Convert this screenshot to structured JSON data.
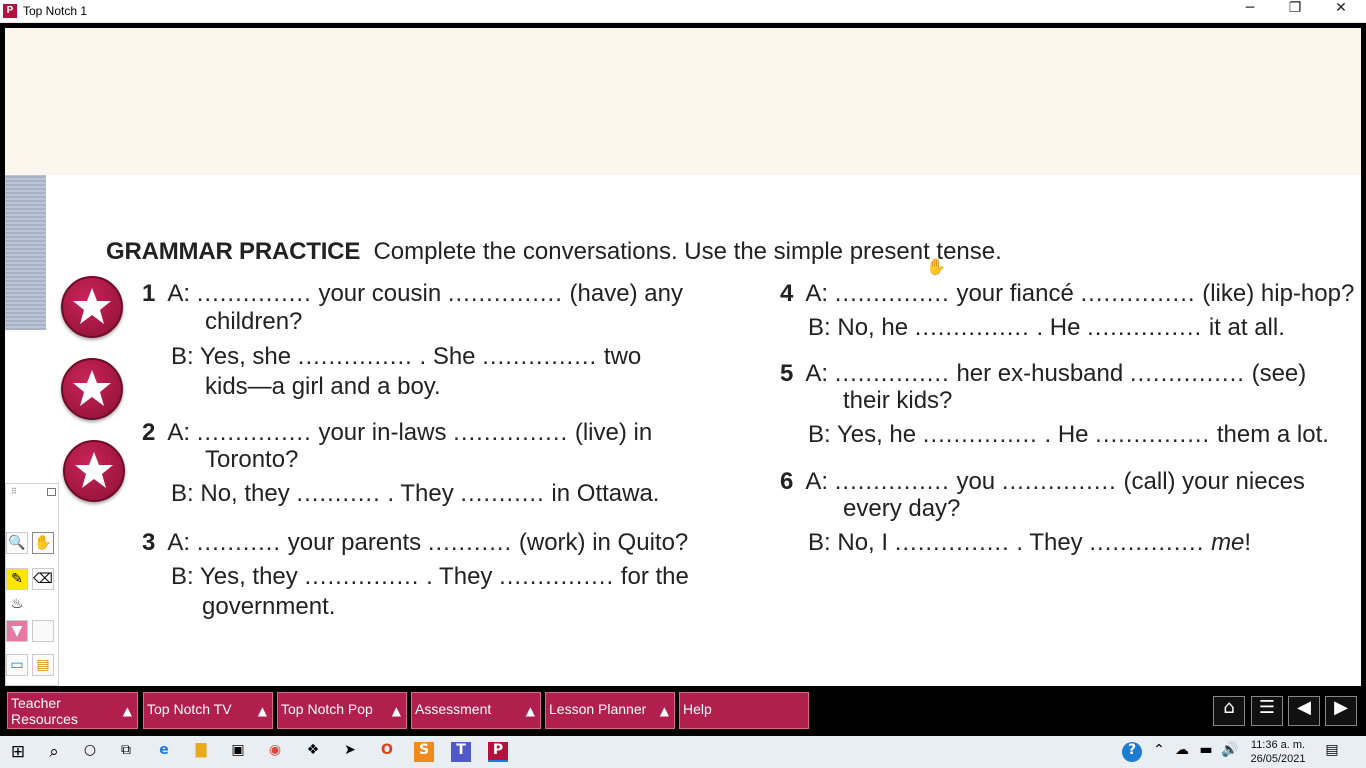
{
  "window": {
    "title": "Top Notch 1",
    "app_icon_letter": "P",
    "minimize": "─",
    "restore": "❐",
    "close": "✕"
  },
  "lesson": {
    "heading_bold": "GRAMMAR PRACTICE",
    "heading_text": "Complete the conversations. Use the simple present tense.",
    "blank": "...............",
    "short_blank": "...........",
    "exercises": {
      "e1": {
        "num": "1",
        "a1": "A:",
        "a2": "your cousin",
        "a3": "(have) any",
        "a4": "children?",
        "b1": "B:",
        "b2": "Yes, she",
        "b3": ". She",
        "b4": "two",
        "b5": "kids—a girl and a boy."
      },
      "e2": {
        "num": "2",
        "a1": "A:",
        "a2": "your in-laws",
        "a3": "(live) in",
        "a4": "Toronto?",
        "b1": "B:",
        "b2": "No, they",
        "b3": ". They",
        "b4": "in Ottawa."
      },
      "e3": {
        "num": "3",
        "a1": "A:",
        "a2": "your parents",
        "a3": "(work) in Quito?",
        "b1": "B:",
        "b2": "Yes, they",
        "b3": ". They",
        "b4": "for the",
        "b5": "government."
      },
      "e4": {
        "num": "4",
        "a1": "A:",
        "a2": "your fiancé",
        "a3": "(like) hip-hop?",
        "b1": "B:",
        "b2": "No, he",
        "b3": ". He",
        "b4": "it at all."
      },
      "e5": {
        "num": "5",
        "a1": "A:",
        "a2": "her ex-husband",
        "a3": "(see)",
        "a4": "their kids?",
        "b1": "B:",
        "b2": "Yes, he",
        "b3": ". He",
        "b4": "them a lot."
      },
      "e6": {
        "num": "6",
        "a1": "A:",
        "a2": "you",
        "a3": "(call) your nieces",
        "a4": "every day?",
        "b1": "B:",
        "b2": "No, I",
        "b3": ". They",
        "b4": "me",
        "b5": "!"
      }
    }
  },
  "toolbar": {
    "grip": "⠿",
    "zoom_icon": "🔍",
    "hand_icon": "✋",
    "highlighter_icon": "✎",
    "eraser_icon": "⌫",
    "spray_icon": "♨",
    "color_swatch": "▼",
    "screen_icon": "▭",
    "folder_icon": "▤",
    "pink": "#e47aa0"
  },
  "menu": {
    "teacher_resources": "Teacher Resources",
    "top_notch_tv": "Top Notch TV",
    "top_notch_pop": "Top Notch Pop",
    "assessment": "Assessment",
    "lesson_planner": "Lesson Planner",
    "help": "Help",
    "arrow": "▲",
    "accent": "#b01f4d"
  },
  "nav": {
    "home_icon": "⌂",
    "list_icon": "☰",
    "prev_icon": "◀",
    "next_icon": "▶"
  },
  "taskbar": {
    "start_icon": "⊞",
    "search_icon": "⌕",
    "cortana_icon": "○",
    "taskview_icon": "⧉",
    "edge_icon": "e",
    "explorer_icon": "▇",
    "store_icon": "▣",
    "chrome_icon": "◉",
    "dropbox_icon": "❖",
    "app_icon": "➤",
    "office_icon": "O",
    "sumatra_icon": "S",
    "teams_icon": "T",
    "pearson_icon": "P",
    "help_icon": "?",
    "chevron_icon": "⌃",
    "cloud_icon": "☁",
    "battery_icon": "▬",
    "volume_icon": "🔊",
    "time": "11:36 a. m.",
    "date": "26/05/2021",
    "notification_icon": "▤"
  }
}
